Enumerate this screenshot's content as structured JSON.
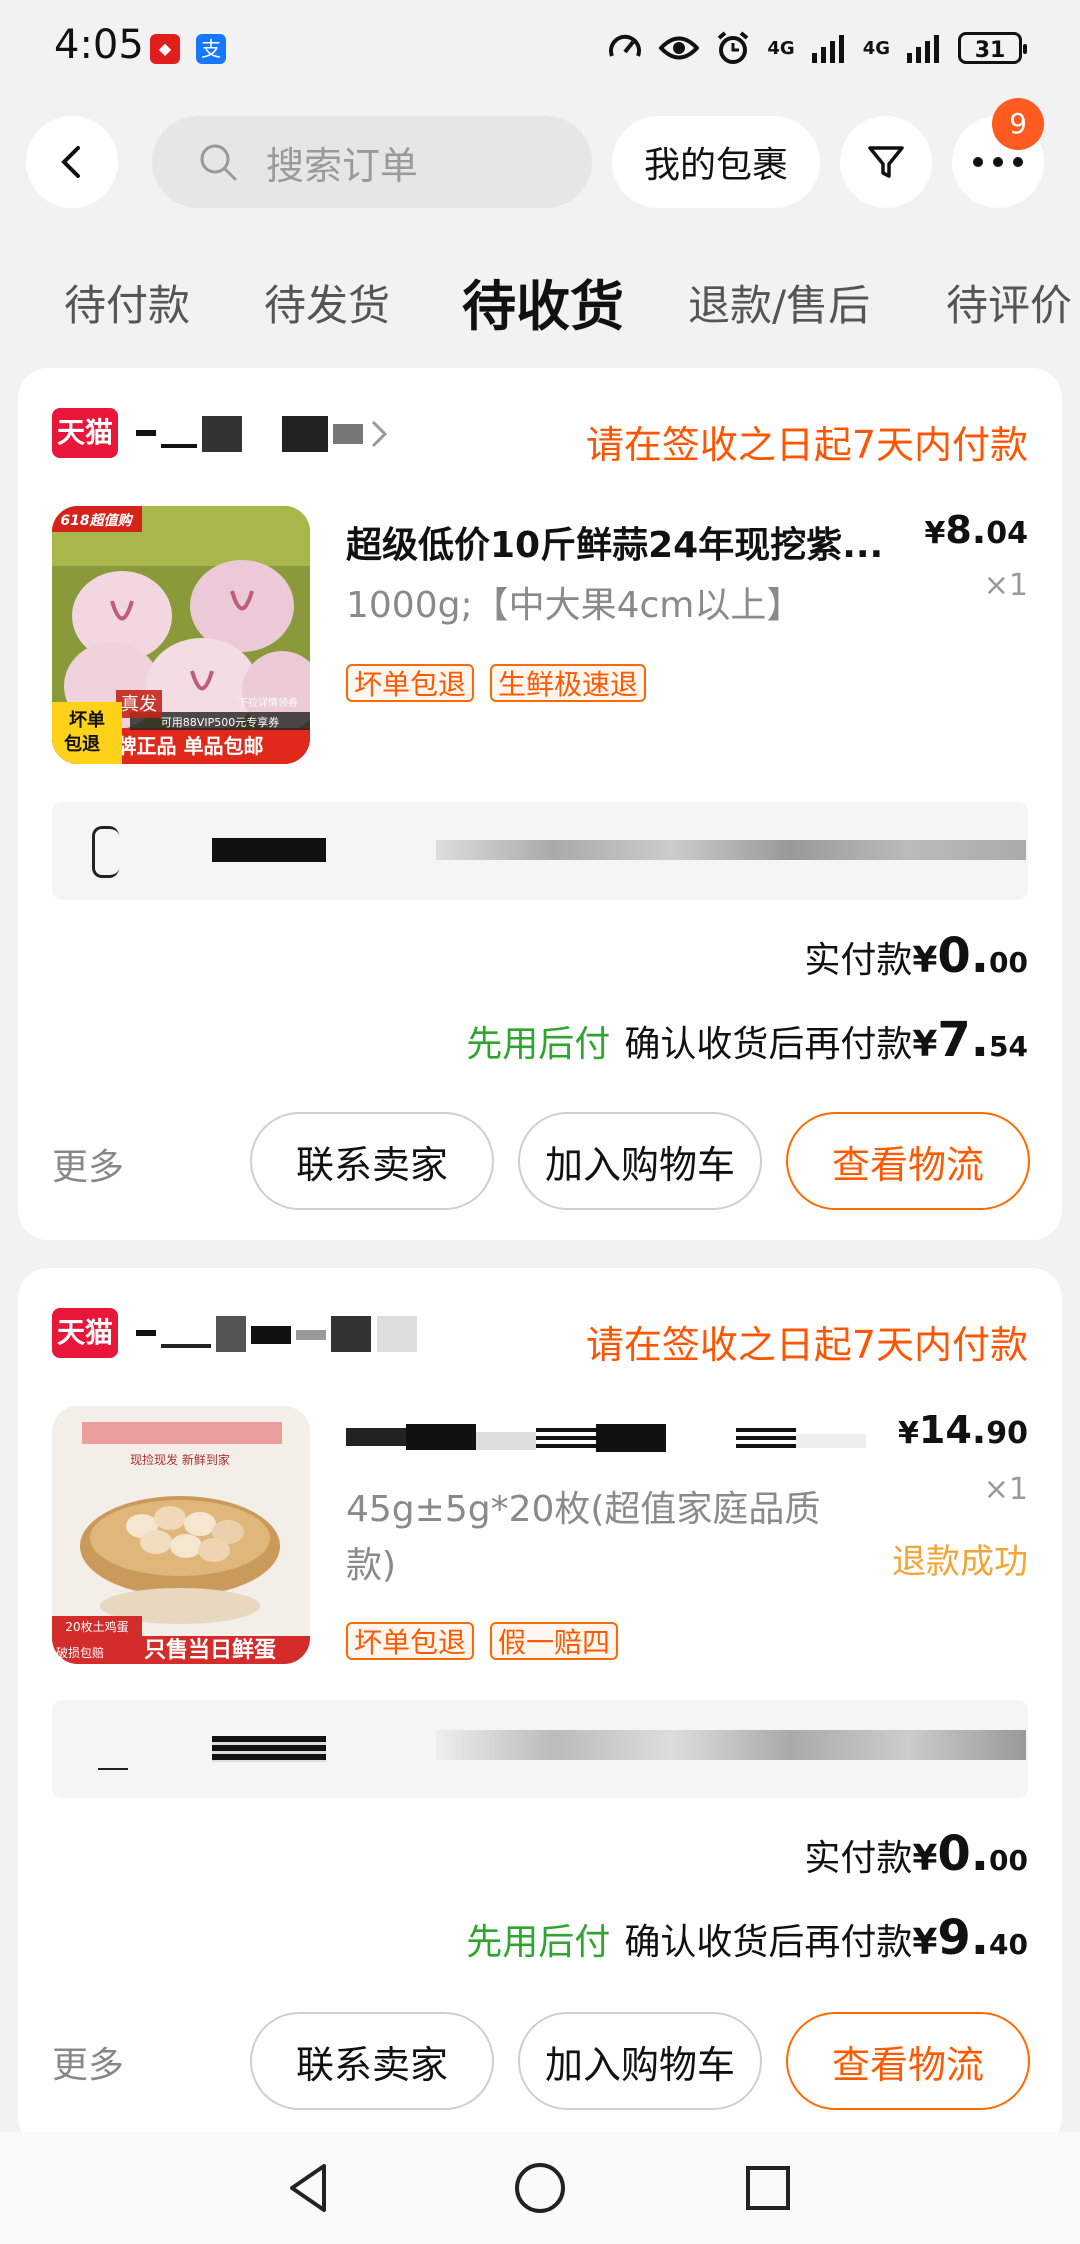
{
  "status_bar": {
    "time": "4:05",
    "app_icons": [
      "app-icon-red",
      "alipay-icon"
    ],
    "alipay_glyph": "支",
    "network_1": "4G",
    "network_2": "4G",
    "battery": "31"
  },
  "top_bar": {
    "search_placeholder": "搜索订单",
    "parcel_label": "我的包裹",
    "more_badge": "9"
  },
  "tabs": [
    {
      "label": "待付款",
      "active": false
    },
    {
      "label": "待发货",
      "active": false
    },
    {
      "label": "待收货",
      "active": true
    },
    {
      "label": "退款/售后",
      "active": false
    },
    {
      "label": "待评价",
      "active": false
    }
  ],
  "orders": [
    {
      "shop_logo": "天猫",
      "notice": "请在签收之日起7天内付款",
      "title": "超级低价10斤鲜蒜24年现挖紫...",
      "spec": "1000g;【中大果4cm以上】",
      "price_symbol": "¥",
      "price_int": "8.",
      "price_dec": "04",
      "qty": "×1",
      "status": "",
      "tags": [
        "坏单包退",
        "生鲜极速退"
      ],
      "image_labels": {
        "badge": "618超值购",
        "corner_1": "坏单",
        "corner_2": "包退",
        "mark": "真发",
        "banner": "品牌正品 单品包邮",
        "coupon": "可用88VIP500元专享券",
        "top_right": "下拉详情领券"
      },
      "paid_label": "实付款",
      "paid_symbol": "¥",
      "paid_int": "0.",
      "paid_dec": "00",
      "later_label": "先用后付",
      "later_text": "确认收货后再付款",
      "later_symbol": "¥",
      "later_int": "7.",
      "later_dec": "54",
      "more": "更多",
      "btn_contact": "联系卖家",
      "btn_cart": "加入购物车",
      "btn_logistics": "查看物流"
    },
    {
      "shop_logo": "天猫",
      "notice": "请在签收之日起7天内付款",
      "title": "",
      "spec": "45g±5g*20枚(超值家庭品质款)",
      "price_symbol": "¥",
      "price_int": "14.",
      "price_dec": "90",
      "qty": "×1",
      "status": "退款成功",
      "tags": [
        "坏单包退",
        "假一赔四"
      ],
      "image_labels": {
        "sub": "现捡现发 新鲜到家",
        "count": "20枚土鸡蛋",
        "banner": "只售当日鲜蛋",
        "ship": "破损包赔"
      },
      "paid_label": "实付款",
      "paid_symbol": "¥",
      "paid_int": "0.",
      "paid_dec": "00",
      "later_label": "先用后付",
      "later_text": "确认收货后再付款",
      "later_symbol": "¥",
      "later_int": "9.",
      "later_dec": "40",
      "more": "更多",
      "btn_contact": "联系卖家",
      "btn_cart": "加入购物车",
      "btn_logistics": "查看物流"
    }
  ],
  "colors": {
    "accent_orange": "#ff5500",
    "tmall_red": "#e8173a",
    "pay_later_green": "#2ea52e",
    "refund_status": "#f3a534"
  },
  "nav_bar": [
    "back-triangle-icon",
    "home-circle-icon",
    "recents-square-icon"
  ]
}
